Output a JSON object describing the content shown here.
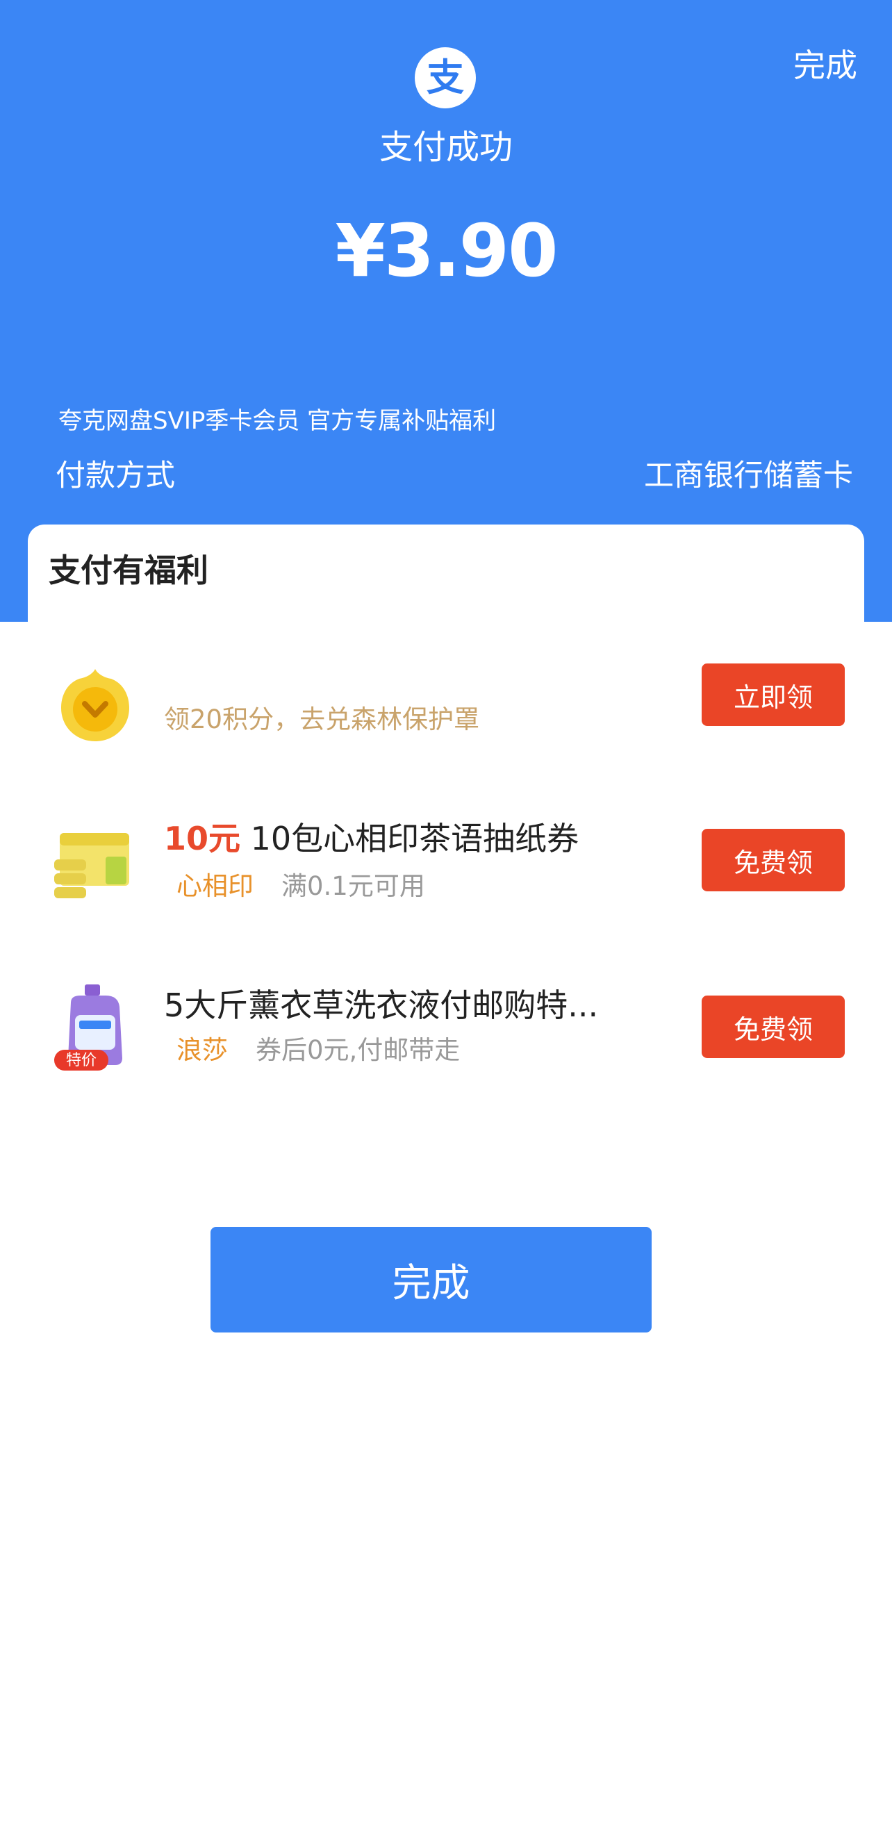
{
  "header": {
    "top_done": "完成",
    "logo_char": "支",
    "status": "支付成功",
    "amount": "¥3.90",
    "description": "夸克网盘SVIP季卡会员 官方专属补贴福利",
    "payment_label": "付款方式",
    "payment_value": "工商银行储蓄卡"
  },
  "benefits": {
    "title": "支付有福利",
    "items": [
      {
        "icon": "gold-coin-icon",
        "title": "",
        "subtitle": "领20积分，去兑森林保护罩",
        "button": "立即领"
      },
      {
        "icon": "tissue-pack-image",
        "price": "10元",
        "title": "10包心相印茶语抽纸券",
        "brand": "心相印",
        "subtitle": "满0.1元可用",
        "button": "免费领"
      },
      {
        "icon": "laundry-detergent-image",
        "badge": "特价",
        "title": "5大斤薰衣草洗衣液付邮购特...",
        "brand": "浪莎",
        "subtitle": "券后0元,付邮带走",
        "button": "免费领"
      }
    ]
  },
  "footer": {
    "done_button": "完成"
  },
  "colors": {
    "brand_blue": "#3b86f5",
    "accent_red": "#ea4527",
    "brand_orange": "#e8912a"
  }
}
